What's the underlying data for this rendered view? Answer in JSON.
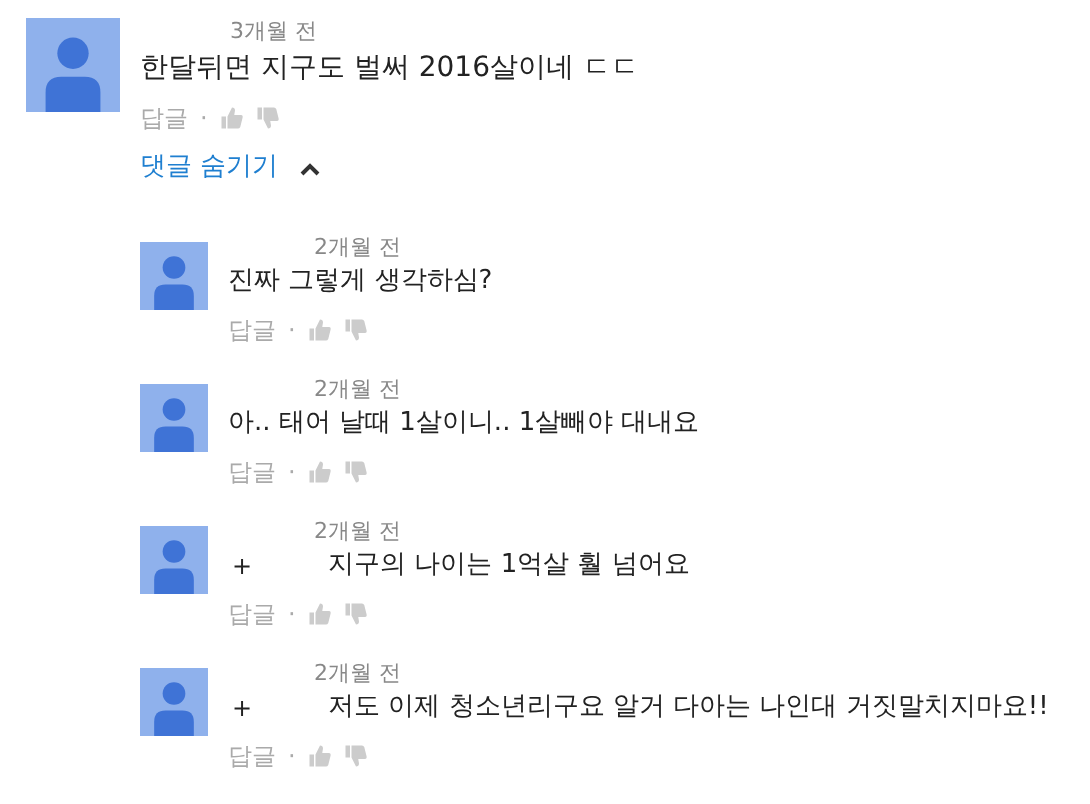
{
  "comment": {
    "time": "3개월 전",
    "text": "한달뒤면 지구도 벌써 2016살이네 ㄷㄷ",
    "reply_label": "답글",
    "separator": "·",
    "hide_replies": "댓글 숨기기",
    "expanded": true
  },
  "replies": [
    {
      "time": "2개월 전",
      "text": "진짜 그렇게 생각하심?",
      "reply_label": "답글",
      "separator": "·"
    },
    {
      "time": "2개월 전",
      "text": "아.. 태어 날때 1살이니.. 1살빼야 대내요",
      "reply_label": "답글",
      "separator": "·"
    },
    {
      "time": "2개월 전",
      "prefix": "+",
      "text": "지구의 나이는 1억살 훨 넘어요",
      "reply_label": "답글",
      "separator": "·"
    },
    {
      "time": "2개월 전",
      "prefix": "+",
      "text": "저도 이제 청소년리구요 알거 다아는 나인대 거짓말치지마요!!",
      "reply_label": "답글",
      "separator": "·"
    }
  ]
}
